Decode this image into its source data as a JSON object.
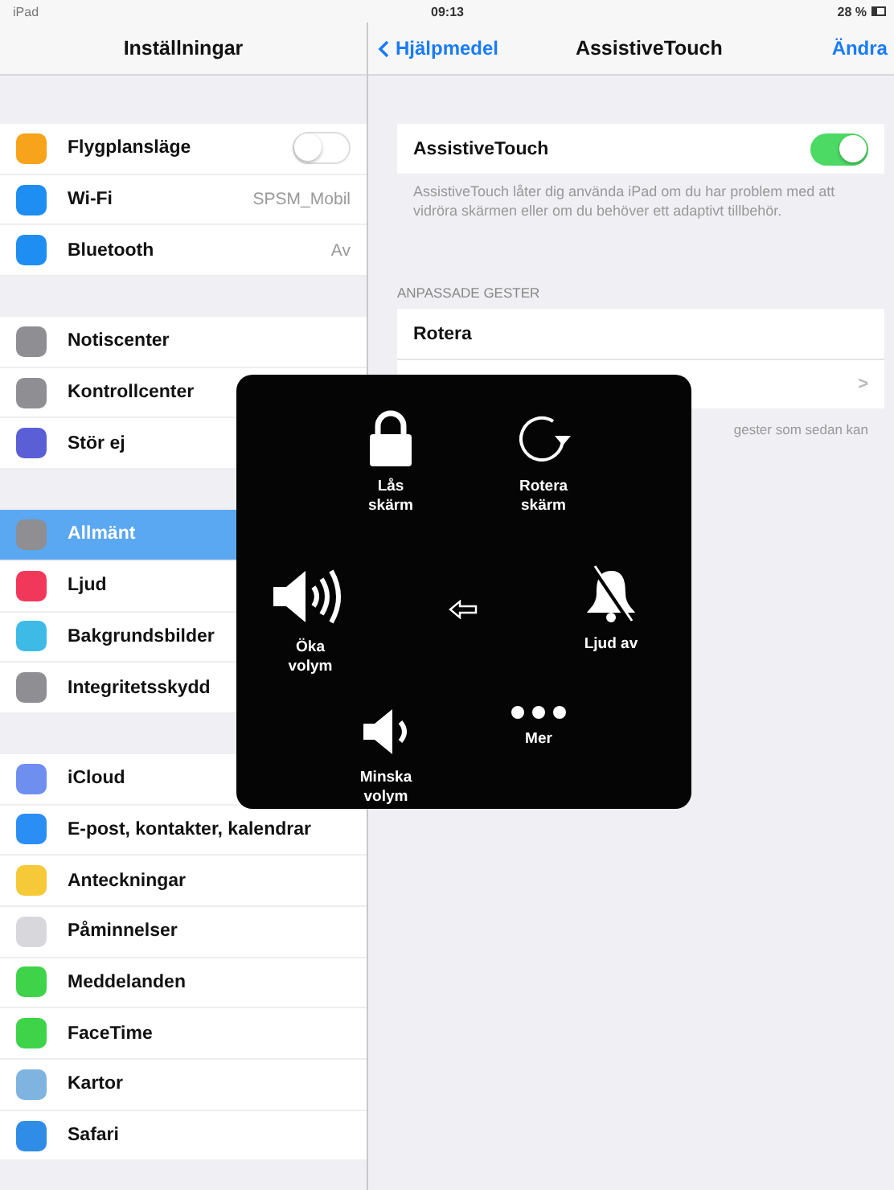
{
  "status_bar": {
    "device": "iPad",
    "time": "09:13",
    "battery": "28 %"
  },
  "sidebar": {
    "title": "Inställningar",
    "groups": [
      [
        {
          "label": "Flygplansläge",
          "color": "#f7a31c",
          "kind": "toggle",
          "on": false,
          "selected": false
        },
        {
          "label": "Wi-Fi",
          "color": "#1e8ef2",
          "kind": "value",
          "value": "SPSM_Mobil",
          "selected": false
        },
        {
          "label": "Bluetooth",
          "color": "#1e8ef2",
          "kind": "value",
          "value": "Av",
          "selected": false
        }
      ],
      [
        {
          "label": "Notiscenter",
          "color": "#8e8e93",
          "kind": "plain",
          "selected": false
        },
        {
          "label": "Kontrollcenter",
          "color": "#8e8e93",
          "kind": "plain",
          "selected": false
        },
        {
          "label": "Stör ej",
          "color": "#5b5fd6",
          "kind": "plain",
          "selected": false
        }
      ],
      [
        {
          "label": "Allmänt",
          "color": "#8e8e93",
          "kind": "plain",
          "selected": true
        },
        {
          "label": "Ljud",
          "color": "#f2385a",
          "kind": "plain",
          "selected": false
        },
        {
          "label": "Bakgrundsbilder",
          "color": "#3dbbe6",
          "kind": "plain",
          "selected": false
        },
        {
          "label": "Integritetsskydd",
          "color": "#8e8e93",
          "kind": "plain",
          "selected": false
        }
      ],
      [
        {
          "label": "iCloud",
          "color": "#6f8ff0",
          "kind": "plain",
          "selected": false
        },
        {
          "label": "E-post, kontakter, kalendrar",
          "color": "#2a8ef5",
          "kind": "plain",
          "selected": false
        },
        {
          "label": "Anteckningar",
          "color": "#f5c938",
          "kind": "plain",
          "selected": false
        },
        {
          "label": "Påminnelser",
          "color": "#d8d8dc",
          "kind": "plain",
          "selected": false
        },
        {
          "label": "Meddelanden",
          "color": "#3fd34a",
          "kind": "plain",
          "selected": false
        },
        {
          "label": "FaceTime",
          "color": "#3fd34a",
          "kind": "plain",
          "selected": false
        },
        {
          "label": "Kartor",
          "color": "#7fb4e0",
          "kind": "plain",
          "selected": false
        },
        {
          "label": "Safari",
          "color": "#2f8de8",
          "kind": "plain",
          "selected": false
        }
      ]
    ]
  },
  "detail": {
    "back": "Hjälpmedel",
    "title": "AssistiveTouch",
    "action": "Ändra",
    "toggle": {
      "label": "AssistiveTouch",
      "on": true
    },
    "description": "AssistiveTouch låter dig använda iPad om du har problem med att vidröra skärmen eller om du behöver ett adaptivt tillbehör.",
    "section_header": "ANPASSADE GESTER",
    "rows": [
      {
        "kind": "label",
        "label": "Rotera"
      },
      {
        "kind": "chevron",
        "chevron": ">"
      }
    ],
    "footer": "gester som sedan kan"
  },
  "overlay": {
    "items": [
      {
        "kind": "lock",
        "label": "Lås skärm"
      },
      {
        "kind": "rotate",
        "label": "Rotera skärm"
      },
      {
        "kind": "volume-up",
        "label": "Öka volym"
      },
      {
        "kind": "back"
      },
      {
        "kind": "mute",
        "label": "Ljud av"
      },
      {
        "kind": "volume-down",
        "label": "Minska volym"
      },
      {
        "kind": "more",
        "label": "Mer"
      }
    ]
  }
}
